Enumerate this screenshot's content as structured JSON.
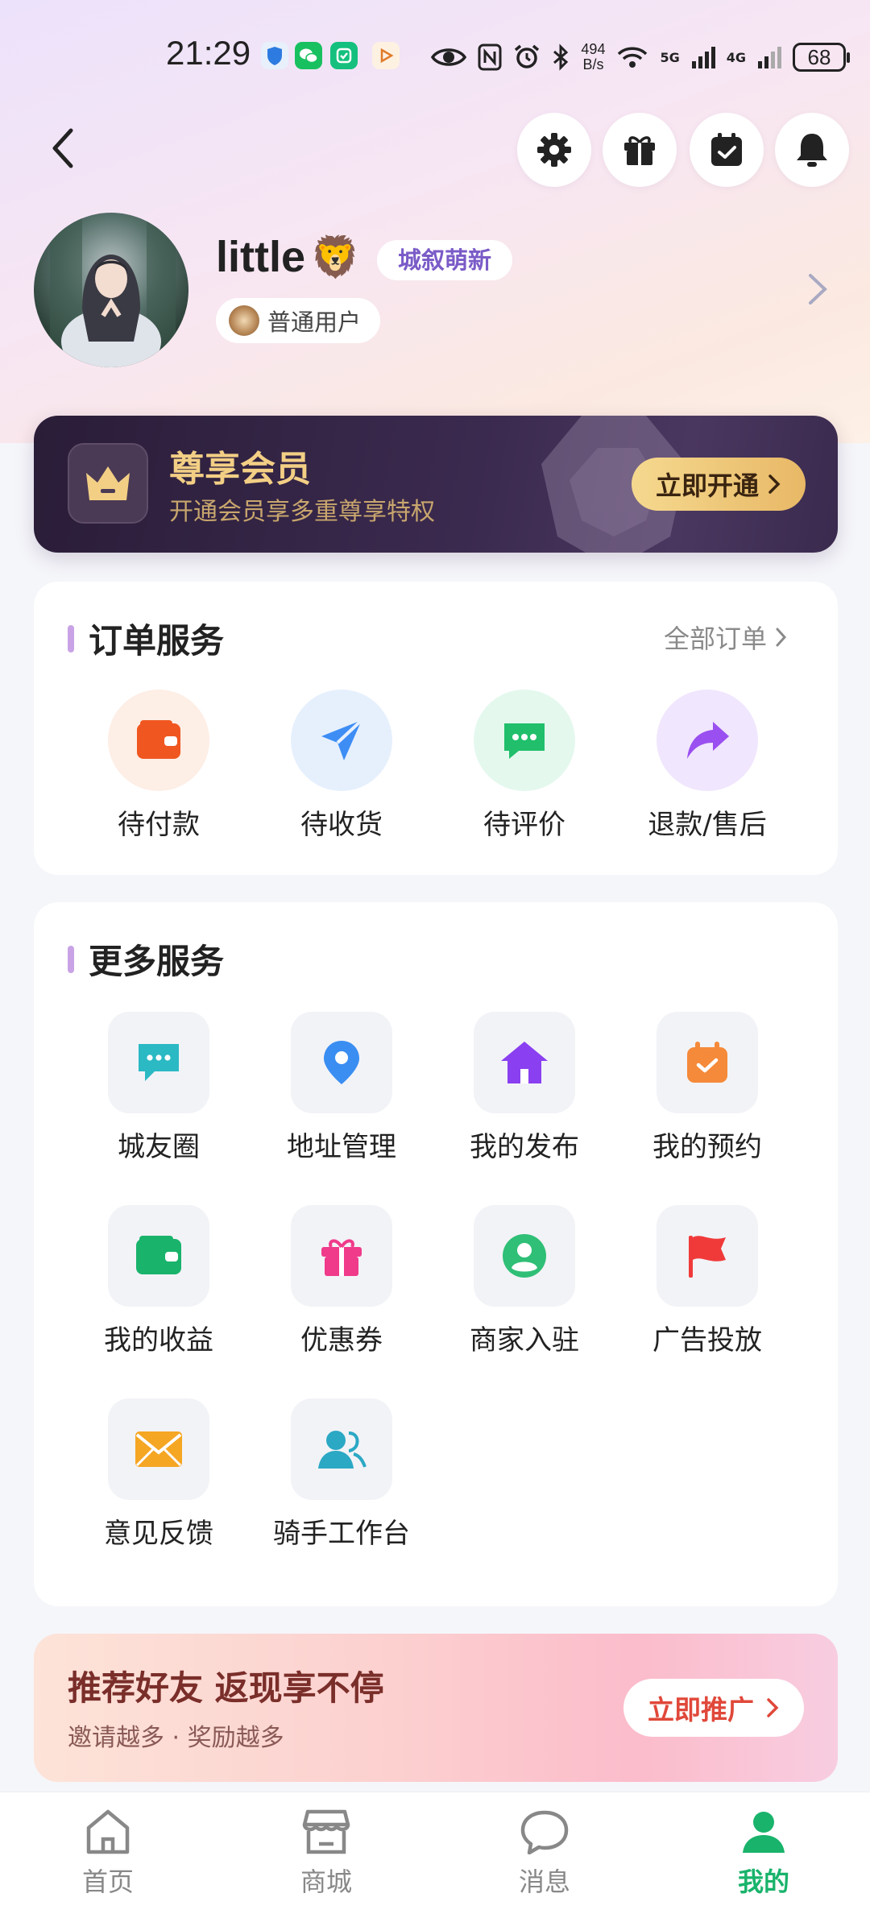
{
  "status_bar": {
    "time": "21:29",
    "net_speed_value": "494",
    "net_speed_unit": "B/s",
    "net_tag_5g": "5G",
    "net_tag_4g": "4G",
    "battery": "68"
  },
  "header": {
    "icons": [
      "back-icon",
      "settings-icon",
      "gift-icon",
      "calendar-check-icon",
      "bell-icon"
    ]
  },
  "profile": {
    "username": "little",
    "username_emoji": "🦁",
    "level_badge": "城叙萌新",
    "role": "普通用户"
  },
  "vip": {
    "title": "尊享会员",
    "subtitle": "开通会员享多重尊享特权",
    "button": "立即开通"
  },
  "orders": {
    "title": "订单服务",
    "all_link": "全部订单",
    "items": [
      {
        "label": "待付款",
        "icon": "wallet-icon",
        "color": "#f0561f",
        "bg": "#fdeee6"
      },
      {
        "label": "待收货",
        "icon": "send-icon",
        "color": "#3d8df5",
        "bg": "#e6f0fd"
      },
      {
        "label": "待评价",
        "icon": "chat-icon",
        "color": "#21bf6b",
        "bg": "#e4f8ee"
      },
      {
        "label": "退款/售后",
        "icon": "refund-arrow-icon",
        "color": "#9a4ff0",
        "bg": "#f0e6fd"
      }
    ]
  },
  "more_services": {
    "title": "更多服务",
    "items": [
      {
        "label": "城友圈",
        "icon": "community-chat-icon",
        "color": "#2bb9c4"
      },
      {
        "label": "地址管理",
        "icon": "location-pin-icon",
        "color": "#3a8ef2"
      },
      {
        "label": "我的发布",
        "icon": "home-icon",
        "color": "#8a3ff0"
      },
      {
        "label": "我的预约",
        "icon": "calendar-check-icon",
        "color": "#f58a3a"
      },
      {
        "label": "我的收益",
        "icon": "wallet-icon",
        "color": "#19b36b"
      },
      {
        "label": "优惠券",
        "icon": "gift-icon",
        "color": "#f03a8a"
      },
      {
        "label": "商家入驻",
        "icon": "user-circle-icon",
        "color": "#2fbf76"
      },
      {
        "label": "广告投放",
        "icon": "flag-icon",
        "color": "#f03a3a"
      },
      {
        "label": "意见反馈",
        "icon": "mail-icon",
        "color": "#f5a623"
      },
      {
        "label": "骑手工作台",
        "icon": "users-icon",
        "color": "#2ba8c4"
      }
    ]
  },
  "referral": {
    "title": "推荐好友 返现享不停",
    "subtitle": "邀请越多 · 奖励越多",
    "button": "立即推广"
  },
  "bottom_nav": {
    "items": [
      {
        "label": "首页",
        "icon": "home-outline-icon"
      },
      {
        "label": "商城",
        "icon": "store-icon"
      },
      {
        "label": "消息",
        "icon": "message-icon"
      },
      {
        "label": "我的",
        "icon": "profile-icon"
      }
    ],
    "active": "我的",
    "active_color": "#19b36b"
  }
}
